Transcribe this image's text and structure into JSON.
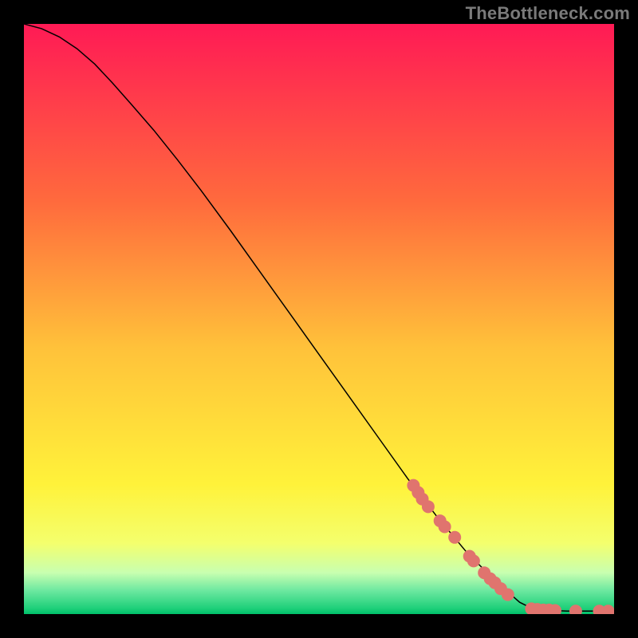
{
  "watermark": "TheBottleneck.com",
  "chart_data": {
    "type": "line",
    "title": "",
    "xlabel": "",
    "ylabel": "",
    "xlim": [
      0,
      100
    ],
    "ylim": [
      0,
      100
    ],
    "grid": false,
    "background_gradient_stops": [
      {
        "offset": 0.0,
        "color": "#ff1a55"
      },
      {
        "offset": 0.3,
        "color": "#ff6a3d"
      },
      {
        "offset": 0.55,
        "color": "#ffc23a"
      },
      {
        "offset": 0.78,
        "color": "#fff23a"
      },
      {
        "offset": 0.88,
        "color": "#f4ff6d"
      },
      {
        "offset": 0.93,
        "color": "#c8ffb0"
      },
      {
        "offset": 0.96,
        "color": "#6de8a0"
      },
      {
        "offset": 0.99,
        "color": "#1fd07a"
      },
      {
        "offset": 1.0,
        "color": "#00c06a"
      }
    ],
    "series": [
      {
        "name": "bottleneck-curve",
        "color": "#000000",
        "width": 1.5,
        "points": [
          {
            "x": 0,
            "y": 100
          },
          {
            "x": 3,
            "y": 99.2
          },
          {
            "x": 6,
            "y": 97.8
          },
          {
            "x": 9,
            "y": 95.8
          },
          {
            "x": 12,
            "y": 93.2
          },
          {
            "x": 15,
            "y": 90.0
          },
          {
            "x": 18,
            "y": 86.6
          },
          {
            "x": 22,
            "y": 82.0
          },
          {
            "x": 26,
            "y": 77.0
          },
          {
            "x": 30,
            "y": 71.8
          },
          {
            "x": 35,
            "y": 65.0
          },
          {
            "x": 40,
            "y": 58.0
          },
          {
            "x": 45,
            "y": 51.0
          },
          {
            "x": 50,
            "y": 44.0
          },
          {
            "x": 55,
            "y": 37.0
          },
          {
            "x": 60,
            "y": 30.0
          },
          {
            "x": 65,
            "y": 23.0
          },
          {
            "x": 70,
            "y": 16.5
          },
          {
            "x": 75,
            "y": 10.5
          },
          {
            "x": 80,
            "y": 5.5
          },
          {
            "x": 84,
            "y": 2.0
          },
          {
            "x": 86,
            "y": 1.0
          },
          {
            "x": 88,
            "y": 0.7
          },
          {
            "x": 92,
            "y": 0.5
          },
          {
            "x": 96,
            "y": 0.5
          },
          {
            "x": 100,
            "y": 0.5
          }
        ]
      }
    ],
    "scatter": {
      "name": "highlighted-points",
      "color": "#e0746e",
      "radius": 8,
      "points": [
        {
          "x": 66.0,
          "y": 21.8
        },
        {
          "x": 66.8,
          "y": 20.6
        },
        {
          "x": 67.5,
          "y": 19.5
        },
        {
          "x": 68.5,
          "y": 18.2
        },
        {
          "x": 70.5,
          "y": 15.8
        },
        {
          "x": 71.3,
          "y": 14.8
        },
        {
          "x": 73.0,
          "y": 13.0
        },
        {
          "x": 75.5,
          "y": 9.8
        },
        {
          "x": 76.2,
          "y": 9.0
        },
        {
          "x": 78.0,
          "y": 7.0
        },
        {
          "x": 79.0,
          "y": 6.0
        },
        {
          "x": 79.8,
          "y": 5.3
        },
        {
          "x": 80.8,
          "y": 4.3
        },
        {
          "x": 82.0,
          "y": 3.3
        },
        {
          "x": 86.0,
          "y": 0.9
        },
        {
          "x": 87.0,
          "y": 0.8
        },
        {
          "x": 88.0,
          "y": 0.7
        },
        {
          "x": 89.0,
          "y": 0.7
        },
        {
          "x": 90.0,
          "y": 0.6
        },
        {
          "x": 93.5,
          "y": 0.5
        },
        {
          "x": 97.5,
          "y": 0.5
        },
        {
          "x": 99.0,
          "y": 0.5
        }
      ]
    }
  }
}
